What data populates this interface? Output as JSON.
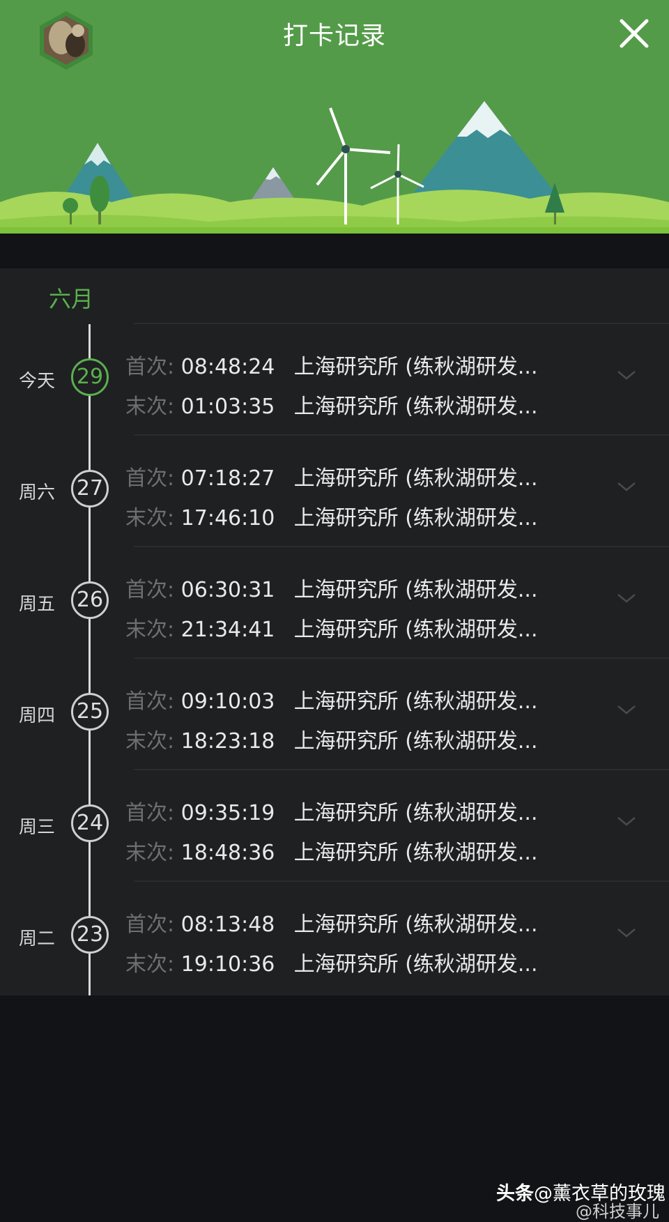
{
  "header": {
    "title": "打卡记录",
    "background_color": "#549b49"
  },
  "list": {
    "month": "六月",
    "first_label": "首次:",
    "last_label": "末次:",
    "accent_color": "#5ab14d",
    "records": [
      {
        "weekday": "今天",
        "day": "29",
        "first_time": "08:48:24",
        "first_location": "上海研究所 (练秋湖研发...",
        "last_time": "01:03:35",
        "last_location": "上海研究所 (练秋湖研发..."
      },
      {
        "weekday": "周六",
        "day": "27",
        "first_time": "07:18:27",
        "first_location": "上海研究所 (练秋湖研发...",
        "last_time": "17:46:10",
        "last_location": "上海研究所 (练秋湖研发..."
      },
      {
        "weekday": "周五",
        "day": "26",
        "first_time": "06:30:31",
        "first_location": "上海研究所 (练秋湖研发...",
        "last_time": "21:34:41",
        "last_location": "上海研究所 (练秋湖研发..."
      },
      {
        "weekday": "周四",
        "day": "25",
        "first_time": "09:10:03",
        "first_location": "上海研究所 (练秋湖研发...",
        "last_time": "18:23:18",
        "last_location": "上海研究所 (练秋湖研发..."
      },
      {
        "weekday": "周三",
        "day": "24",
        "first_time": "09:35:19",
        "first_location": "上海研究所 (练秋湖研发...",
        "last_time": "18:48:36",
        "last_location": "上海研究所 (练秋湖研发..."
      },
      {
        "weekday": "周二",
        "day": "23",
        "first_time": "08:13:48",
        "first_location": "上海研究所 (练秋湖研发...",
        "last_time": "19:10:36",
        "last_location": "上海研究所 (练秋湖研发..."
      }
    ]
  },
  "watermark": {
    "brand": "头条",
    "handle": "@薰衣草的玫瑰",
    "sub_handle": "@科技事儿"
  }
}
